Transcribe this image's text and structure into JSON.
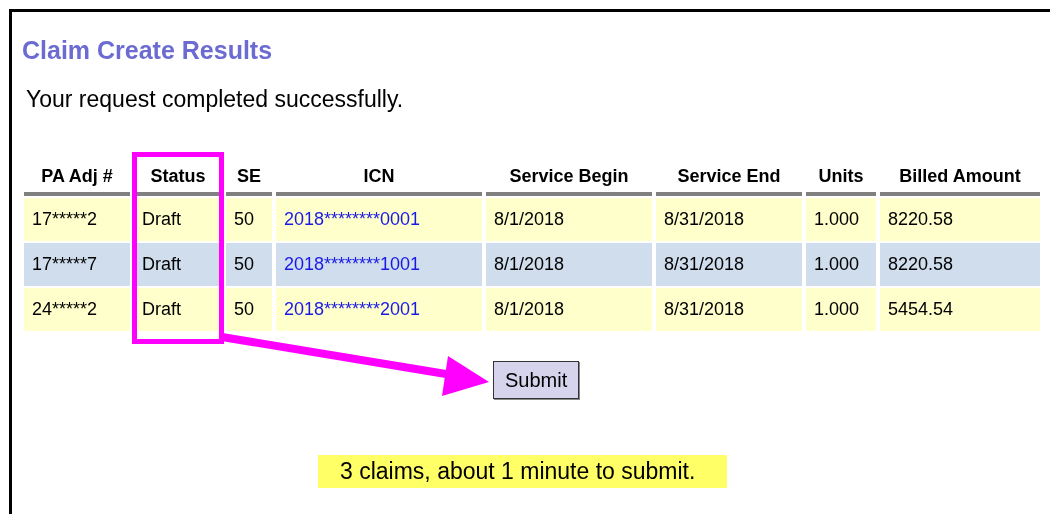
{
  "page": {
    "title": "Claim Create Results",
    "message": "Your request completed successfully."
  },
  "table": {
    "columns": [
      "PA Adj #",
      "Status",
      "SE",
      "ICN",
      "Service Begin",
      "Service End",
      "Units",
      "Billed Amount"
    ],
    "rows": [
      {
        "pa_adj": "17*****2",
        "status": "Draft",
        "se": "50",
        "icn": "2018********0001",
        "service_begin": "8/1/2018",
        "service_end": "8/31/2018",
        "units": "1.000",
        "billed_amount": "8220.58"
      },
      {
        "pa_adj": "17*****7",
        "status": "Draft",
        "se": "50",
        "icn": "2018********1001",
        "service_begin": "8/1/2018",
        "service_end": "8/31/2018",
        "units": "1.000",
        "billed_amount": "8220.58"
      },
      {
        "pa_adj": "24*****2",
        "status": "Draft",
        "se": "50",
        "icn": "2018********2001",
        "service_begin": "8/1/2018",
        "service_end": "8/31/2018",
        "units": "1.000",
        "billed_amount": "5454.54"
      }
    ]
  },
  "submit_button": {
    "label": "Submit"
  },
  "note": "3 claims, about 1 minute to submit."
}
